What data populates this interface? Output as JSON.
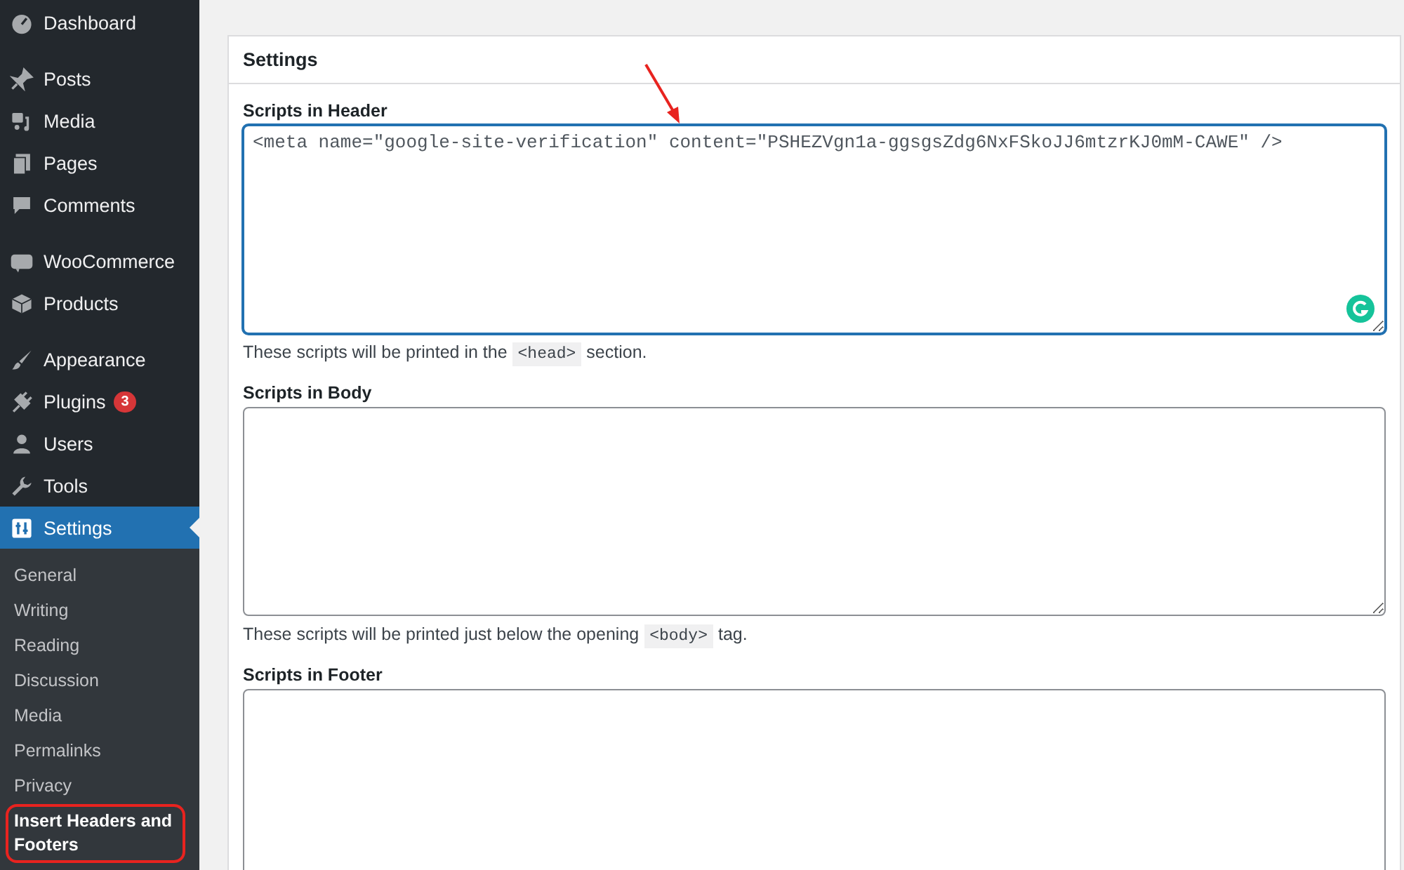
{
  "sidebar": {
    "groups": [
      [
        {
          "kind": "dashboard",
          "label": "Dashboard",
          "selected": false
        }
      ],
      [
        {
          "kind": "pin",
          "label": "Posts",
          "selected": false
        },
        {
          "kind": "media",
          "label": "Media",
          "selected": false
        },
        {
          "kind": "pages",
          "label": "Pages",
          "selected": false
        },
        {
          "kind": "comment",
          "label": "Comments",
          "selected": false
        }
      ],
      [
        {
          "kind": "woo",
          "label": "WooCommerce",
          "selected": false
        },
        {
          "kind": "box",
          "label": "Products",
          "selected": false
        }
      ],
      [
        {
          "kind": "brush",
          "label": "Appearance",
          "selected": false
        },
        {
          "kind": "plug",
          "label": "Plugins",
          "selected": false,
          "badge": "3"
        },
        {
          "kind": "user",
          "label": "Users",
          "selected": false
        },
        {
          "kind": "wrench",
          "label": "Tools",
          "selected": false
        },
        {
          "kind": "sliders",
          "label": "Settings",
          "selected": true
        }
      ]
    ],
    "submenu": [
      {
        "label": "General",
        "selected": false,
        "circled": false
      },
      {
        "label": "Writing",
        "selected": false,
        "circled": false
      },
      {
        "label": "Reading",
        "selected": false,
        "circled": false
      },
      {
        "label": "Discussion",
        "selected": false,
        "circled": false
      },
      {
        "label": "Media",
        "selected": false,
        "circled": false
      },
      {
        "label": "Permalinks",
        "selected": false,
        "circled": false
      },
      {
        "label": "Privacy",
        "selected": false,
        "circled": false
      },
      {
        "label": "Insert Headers and Footers",
        "selected": true,
        "circled": true
      }
    ]
  },
  "panel": {
    "title": "Settings",
    "fields": [
      {
        "label": "Scripts in Header",
        "value": "<meta name=\"google-site-verification\" content=\"PSHEZVgn1a-ggsgsZdg6NxFSkoJJ6mtzrKJ0mM-CAWE\" />",
        "focused": true,
        "assistant": true,
        "arrow": true,
        "help": {
          "before": "These scripts will be printed in the",
          "code": "<head>",
          "after": "section."
        }
      },
      {
        "label": "Scripts in Body",
        "focused": false,
        "help": {
          "before": "These scripts will be printed just below the opening",
          "code": "<body>",
          "after": "tag."
        }
      },
      {
        "label": "Scripts in Footer",
        "focused": false
      }
    ]
  }
}
